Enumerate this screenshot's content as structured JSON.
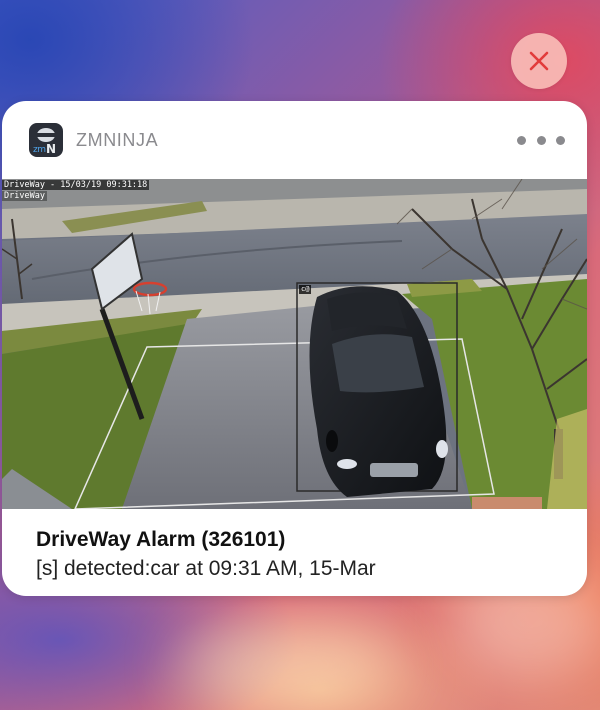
{
  "close_button": {
    "icon": "close-icon",
    "color": "#e23b3b"
  },
  "notification": {
    "app_name": "ZMNINJA",
    "app_icon": {
      "icon": "zmninja-app-icon",
      "zm_text": "zm",
      "n_text": "N"
    },
    "more_icon": "ellipsis-icon",
    "snapshot": {
      "overlay_line_1": "DriveWay - 15/03/19 09:31:18",
      "overlay_line_2": "DriveWay",
      "detection_tag": "c@"
    },
    "title": "DriveWay Alarm (326101)",
    "message": "[s] detected:car at 09:31 AM, 15-Mar"
  }
}
